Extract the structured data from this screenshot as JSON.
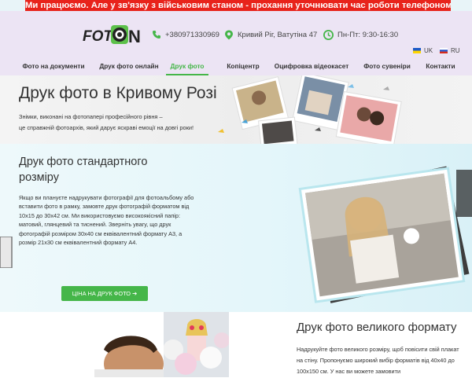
{
  "alert": {
    "text": "Ми працюємо. Але у зв'язку з військовим станом - прохання уточнювати час роботи телефоном заздалегідь!"
  },
  "header": {
    "logo_text": "FOTON",
    "phone": "+380971330969",
    "address": "Кривий Ріг, Ватутіна 47",
    "hours": "Пн-Пт: 9:30-16:30",
    "lang_uk": "UK",
    "lang_ru": "RU"
  },
  "nav": {
    "items": [
      {
        "label": "Фото на документи"
      },
      {
        "label": "Друк фото онлайн"
      },
      {
        "label": "Друк фото"
      },
      {
        "label": "Копіцентр"
      },
      {
        "label": "Оцифровка відеокасет"
      },
      {
        "label": "Фото сувеніри"
      },
      {
        "label": "Контакти"
      }
    ],
    "active": "Друк фото"
  },
  "hero": {
    "title": "Друк фото в Кривому Розі",
    "line1": "Знімки, виконані на фотопапері професійного рівня –",
    "line2": "це справжній фотоархів, який дарує яскраві емоції на довгі роки!"
  },
  "standard": {
    "title": "Друк фото стандартного розміру",
    "body": "Якщо ви плануєте надрукувати фотографії для фотоальбому або вставити фото в рамку, замовте друк фотографій форматом від 10x15 до 30x42 см. Ми використовуємо високоякісний папір: матовий, глянцевий та тиснений. Зверніть увагу, що друк фотографій розміром 30x40 см еквівалентний формату А3, а розмір 21x30 см еквівалентний формату А4.",
    "button": "ЦІНА НА ДРУК ФОТО"
  },
  "large": {
    "title": "Друк фото великого формату",
    "body": "Надрукуйте фото великого розміру, щоб повісити свій плакат на стіну. Пропонуємо широкий вибір форматів від 40x40 до 100x150 см. У нас ви можете замовити"
  },
  "colors": {
    "accent": "#45b649",
    "alert": "#e8231b",
    "header_bg": "#ece4f4"
  }
}
